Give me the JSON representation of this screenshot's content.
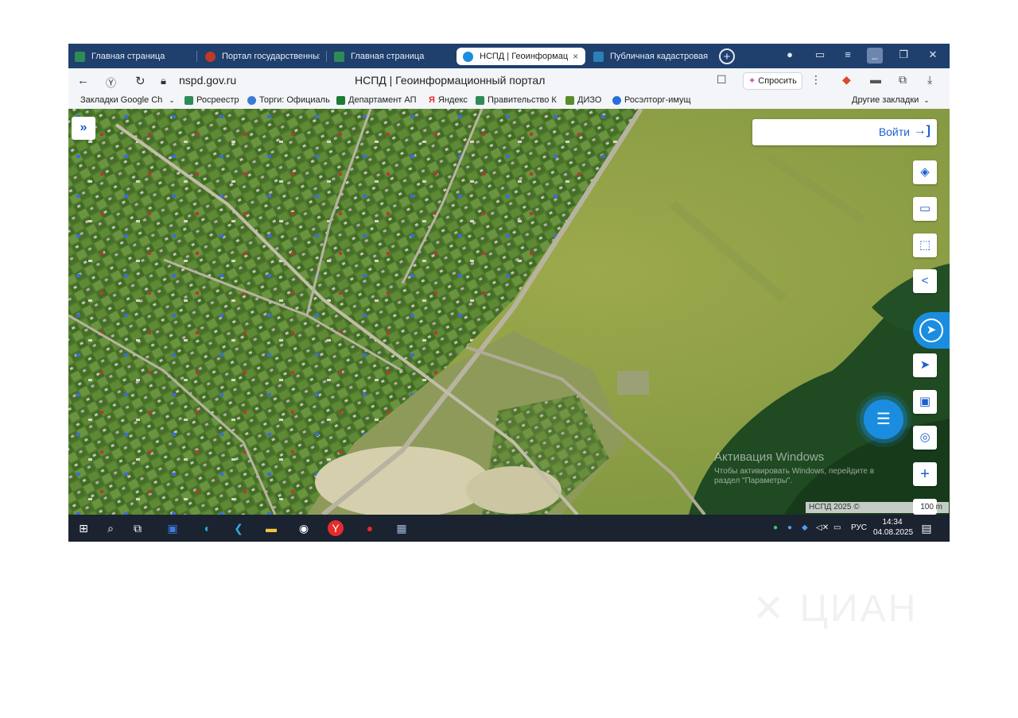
{
  "browser": {
    "tabs": [
      {
        "label": "Главная страница",
        "color": "#2e8b57"
      },
      {
        "label": "Портал государственных",
        "color": "#c0392b"
      },
      {
        "label": "Главная страница",
        "color": "#2e8b57"
      },
      {
        "label": "НСПД | Геоинформац",
        "color": "#1b8de0",
        "active": true
      },
      {
        "label": "Публичная кадастровая",
        "color": "#2c7fb8"
      }
    ],
    "tab_close": "×",
    "url": "nspd.gov.ru",
    "page_title": "НСПД | Геоинформационный портал",
    "ask_button": "Спросить",
    "bookmarks": [
      {
        "label": "Закладки Google Ch",
        "color": ""
      },
      {
        "label": "Росреестр",
        "color": "#2e8b57"
      },
      {
        "label": "Торги: Официаль",
        "color": "#3a7bd5"
      },
      {
        "label": "Департамент АП",
        "color": "#1e7b34"
      },
      {
        "label": "Яндекс",
        "color": "#e52b2b"
      },
      {
        "label": "Правительство К",
        "color": "#2e8b57"
      },
      {
        "label": "ДИЗО",
        "color": "#5b8c2a"
      },
      {
        "label": "Росэлторг-имущ",
        "color": "#2a6fd8"
      }
    ],
    "other_bookmarks": "Другие закладки"
  },
  "map": {
    "login_label": "Войти",
    "watermark_line1": "Активация Windows",
    "watermark_line2": "Чтобы активировать Windows, перейдите в",
    "watermark_line3": "раздел \"Параметры\".",
    "attribution": "НСПД 2025 ©",
    "scale_label": "100 m"
  },
  "taskbar": {
    "language": "РУС",
    "time": "14:34",
    "date": "04.08.2025"
  },
  "colors": {
    "accent": "#1b8de0",
    "tabbar": "#1f3f6d",
    "taskbar": "#1b2230"
  }
}
